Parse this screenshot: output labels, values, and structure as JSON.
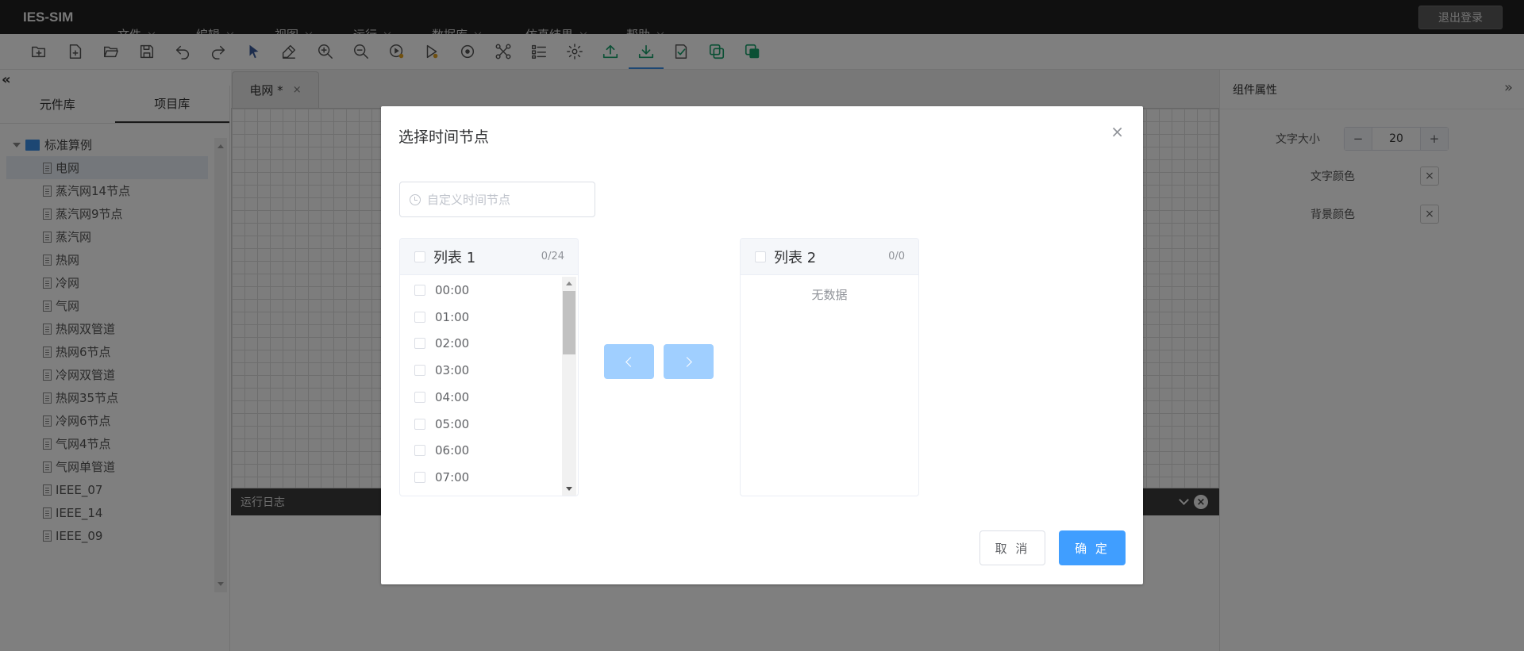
{
  "app": {
    "brand": "IES-SIM",
    "logout_label": "退出登录"
  },
  "menu": [
    "文件",
    "编辑",
    "视图",
    "运行",
    "数据库",
    "仿真结果",
    "帮助"
  ],
  "toolbar": {
    "icons": [
      "new-folder-icon",
      "new-file-icon",
      "open-folder-icon",
      "save-icon",
      "undo-icon",
      "redo-icon",
      "select-cursor-icon",
      "eraser-icon",
      "zoom-in-icon",
      "zoom-out-icon",
      "play-icon",
      "run-select-icon",
      "target-icon",
      "topology-icon",
      "list-icon",
      "settings-icon",
      "upload-icon",
      "download-icon",
      "check-doc-icon",
      "copy-icon",
      "layers-icon"
    ],
    "active_index": 17,
    "accent_color": "#17a06a"
  },
  "left_panel": {
    "tabs": [
      "元件库",
      "项目库"
    ],
    "active_tab": 1,
    "tree_root": "标准算例",
    "tree_items": [
      "电网",
      "蒸汽网14节点",
      "蒸汽网9节点",
      "蒸汽网",
      "热网",
      "冷网",
      "气网",
      "热网双管道",
      "热网6节点",
      "冷网双管道",
      "热网35节点",
      "冷网6节点",
      "气网4节点",
      "气网单管道",
      "IEEE_07",
      "IEEE_14",
      "IEEE_09"
    ],
    "selected_index": 0
  },
  "canvas": {
    "tab_label": "电网 *",
    "tab_close": "×",
    "log_title": "运行日志"
  },
  "right_panel": {
    "title": "组件属性",
    "font_size_label": "文字大小",
    "font_size_value": "20",
    "minus": "−",
    "plus": "+",
    "text_color_label": "文字颜色",
    "bg_color_label": "背景颜色",
    "clear_mark": "×"
  },
  "dialog": {
    "title": "选择时间节点",
    "close": "×",
    "time_placeholder": "自定义时间节点",
    "left_list": {
      "title": "列表 1",
      "count": "0/24",
      "items": [
        "00:00",
        "01:00",
        "02:00",
        "03:00",
        "04:00",
        "05:00",
        "06:00",
        "07:00"
      ]
    },
    "right_list": {
      "title": "列表 2",
      "count": "0/0",
      "empty_text": "无数据"
    },
    "cancel_label": "取 消",
    "ok_label": "确 定",
    "primary_color": "#409eff"
  }
}
